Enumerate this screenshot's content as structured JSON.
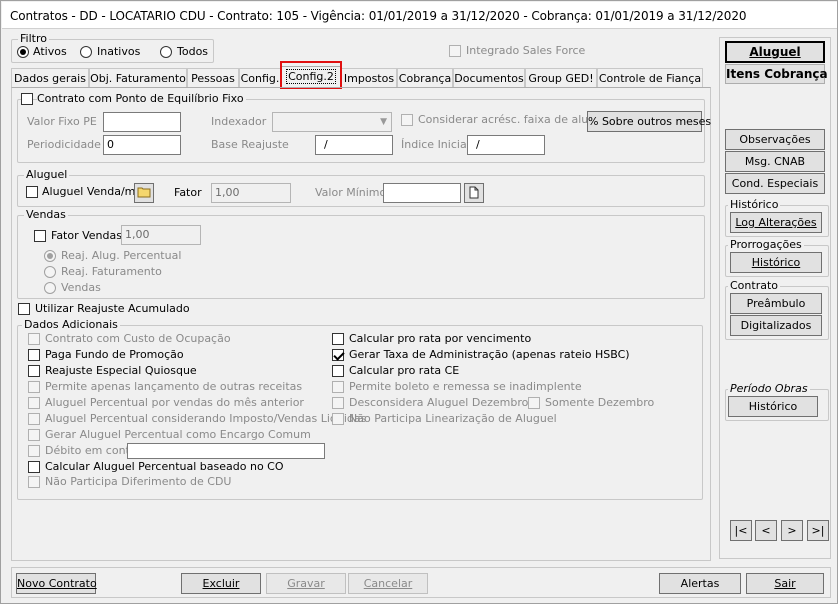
{
  "window": {
    "title": "Contratos - DD - LOCATARIO CDU - Contrato: 105 - Vigência: 01/01/2019 a 31/12/2020 - Cobrança: 01/01/2019 a 31/12/2020"
  },
  "filtro": {
    "label": "Filtro",
    "options": [
      "Ativos",
      "Inativos",
      "Todos"
    ],
    "selected": "Ativos",
    "integrado": "Integrado Sales Force"
  },
  "tabs": [
    "Dados gerais",
    "Obj. Faturamento",
    "Pessoas",
    "Config.",
    "Config.2",
    "Impostos",
    "Cobrança",
    "Documentos",
    "Group GED!",
    "Controle de Fiança"
  ],
  "active_tab": "Config.2",
  "equilibrio": {
    "label": "Contrato com Ponto de Equilíbrio Fixo",
    "valor_fixo_label": "Valor Fixo PE",
    "valor_fixo": "",
    "indexador_label": "Indexador",
    "indexador": "",
    "considerar_label": "Considerar acrésc. faixa de aluguel",
    "sobre_btn": "% Sobre outros meses",
    "periodicidade_label": "Periodicidade",
    "periodicidade": "0",
    "base_label": "Base Reajuste",
    "base": "/",
    "indice_label": "Índice Inicial",
    "indice": "/"
  },
  "aluguel": {
    "group": "Aluguel",
    "venda_label": "Aluguel Venda/m²",
    "fator_label": "Fator",
    "fator": "1,00",
    "valor_min_label": "Valor Mínimo",
    "valor_min": ""
  },
  "vendas": {
    "group": "Vendas",
    "fator_label": "Fator Vendas",
    "fator": "1,00",
    "radios": [
      "Reaj. Alug. Percentual",
      "Reaj. Faturamento",
      "Vendas"
    ],
    "selected": "Reaj. Alug. Percentual"
  },
  "reajuste_acumulado": "Utilizar Reajuste Acumulado",
  "dados": {
    "group": "Dados Adicionais",
    "left": [
      "Contrato com Custo de Ocupação",
      "Paga Fundo de Promoção",
      "Reajuste Especial Quiosque",
      "Permite apenas lançamento de outras receitas",
      "Aluguel Percentual por vendas do mês anterior",
      "Aluguel Percentual considerando Imposto/Vendas Liquidas",
      "Gerar Aluguel Percentual como Encargo Comum",
      "Débito em conta",
      "Calcular Aluguel Percentual baseado no CO",
      "Não Participa Diferimento de CDU"
    ],
    "right": [
      "Calcular pro rata por vencimento",
      "Gerar Taxa de Administração (apenas rateio HSBC)",
      "Calcular pro rata CE",
      "Permite boleto e remessa se inadimplente",
      "Desconsidera Aluguel Dezembro",
      "Não Participa Linearização de Aluguel"
    ],
    "somente": "Somente Dezembro",
    "debito_valor": ""
  },
  "side": {
    "aluguel": "Aluguel",
    "itens": "Itens Cobrança",
    "observacoes": "Observações",
    "cnab": "Msg. CNAB",
    "condicoes": "Cond. Especiais",
    "historico_group": "Histórico",
    "log": "Log Alterações",
    "prorrog_group": "Prorrogações",
    "prorrog_hist": "Histórico",
    "contrato_group": "Contrato",
    "preambulo": "Preâmbulo",
    "digitalizados": "Digitalizados",
    "periodo_group": "Período Obras",
    "periodo_hist": "Histórico"
  },
  "nav": [
    "|<",
    "<",
    ">",
    ">|"
  ],
  "bottom": {
    "novo": "Novo Contrato",
    "excluir": "Excluir",
    "gravar": "Gravar",
    "cancelar": "Cancelar",
    "alertas": "Alertas",
    "sair": "Sair"
  }
}
